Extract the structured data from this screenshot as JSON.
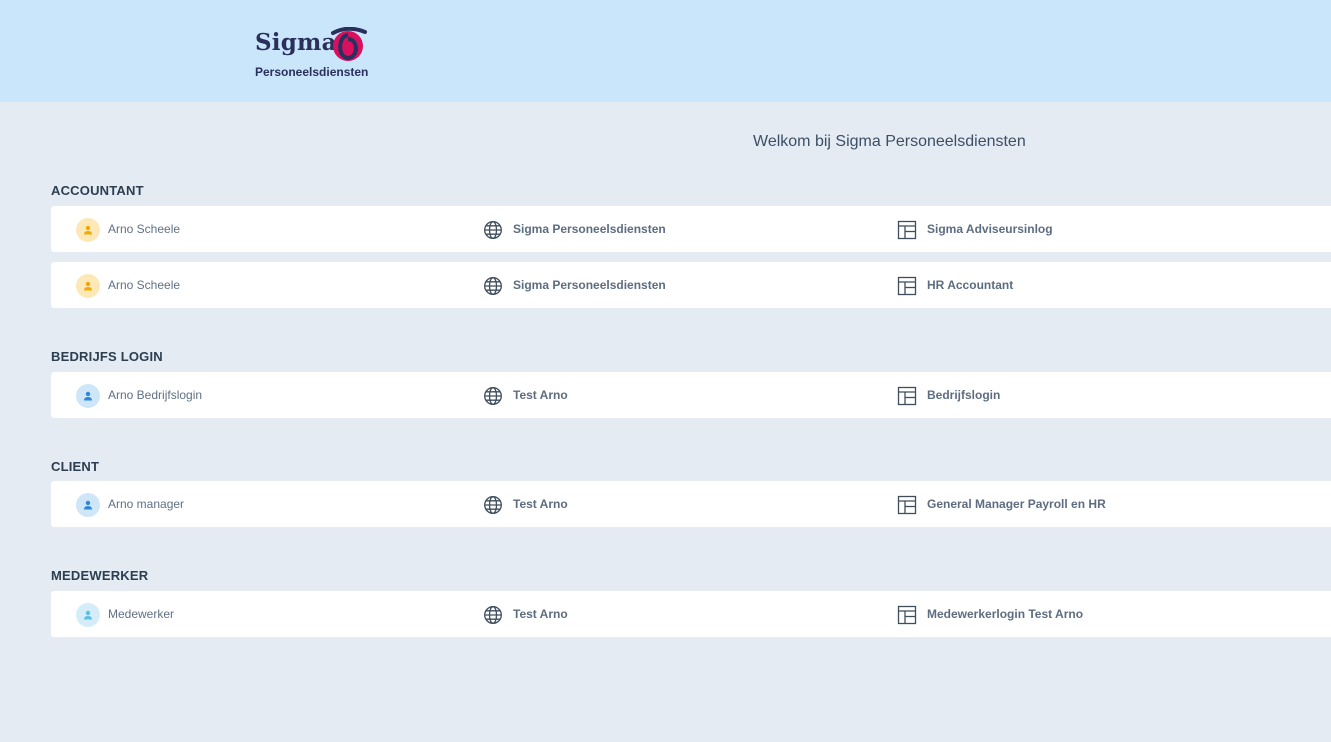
{
  "header": {
    "logo_word": "Sigma",
    "logo_sub": "Personeelsdiensten",
    "brand_color": "#d8105f",
    "navy_color": "#2b2f5c"
  },
  "welcome": "Welkom bij Sigma Personeelsdiensten",
  "colors": {
    "background": "#e4ebf3",
    "header_bg": "#c9e6fa",
    "avatar_accountant_bg": "#fde9b8",
    "avatar_accountant_fg": "#f2a900",
    "avatar_company_bg": "#cfe6f8",
    "avatar_company_fg": "#2e86d6",
    "avatar_employee_bg": "#d4edf9",
    "avatar_employee_fg": "#5cbfe6"
  },
  "groups": [
    {
      "title": "ACCOUNTANT",
      "rows": [
        {
          "user": "Arno Scheele",
          "org": "Sigma Personeelsdiensten",
          "role": "Sigma Adviseursinlog",
          "avatar": "accountant",
          "icons": [
            "user-icon",
            "globe-icon",
            "layout-icon"
          ]
        },
        {
          "user": "Arno Scheele",
          "org": "Sigma Personeelsdiensten",
          "role": "HR Accountant",
          "avatar": "accountant",
          "icons": [
            "user-icon",
            "globe-icon",
            "layout-icon"
          ]
        }
      ]
    },
    {
      "title": "BEDRIJFS LOGIN",
      "rows": [
        {
          "user": "Arno Bedrijfslogin",
          "org": "Test Arno",
          "role": "Bedrijfslogin",
          "avatar": "company",
          "icons": [
            "user-icon",
            "globe-icon",
            "layout-icon"
          ]
        }
      ]
    },
    {
      "title": "CLIENT",
      "rows": [
        {
          "user": "Arno manager",
          "org": "Test Arno",
          "role": "General Manager Payroll en HR",
          "avatar": "company",
          "icons": [
            "user-icon",
            "globe-icon",
            "layout-icon"
          ]
        }
      ]
    },
    {
      "title": "MEDEWERKER",
      "rows": [
        {
          "user": "Medewerker",
          "org": "Test Arno",
          "role": "Medewerkerlogin Test Arno",
          "avatar": "employee",
          "icons": [
            "user-icon",
            "globe-icon",
            "layout-icon"
          ]
        }
      ]
    }
  ]
}
